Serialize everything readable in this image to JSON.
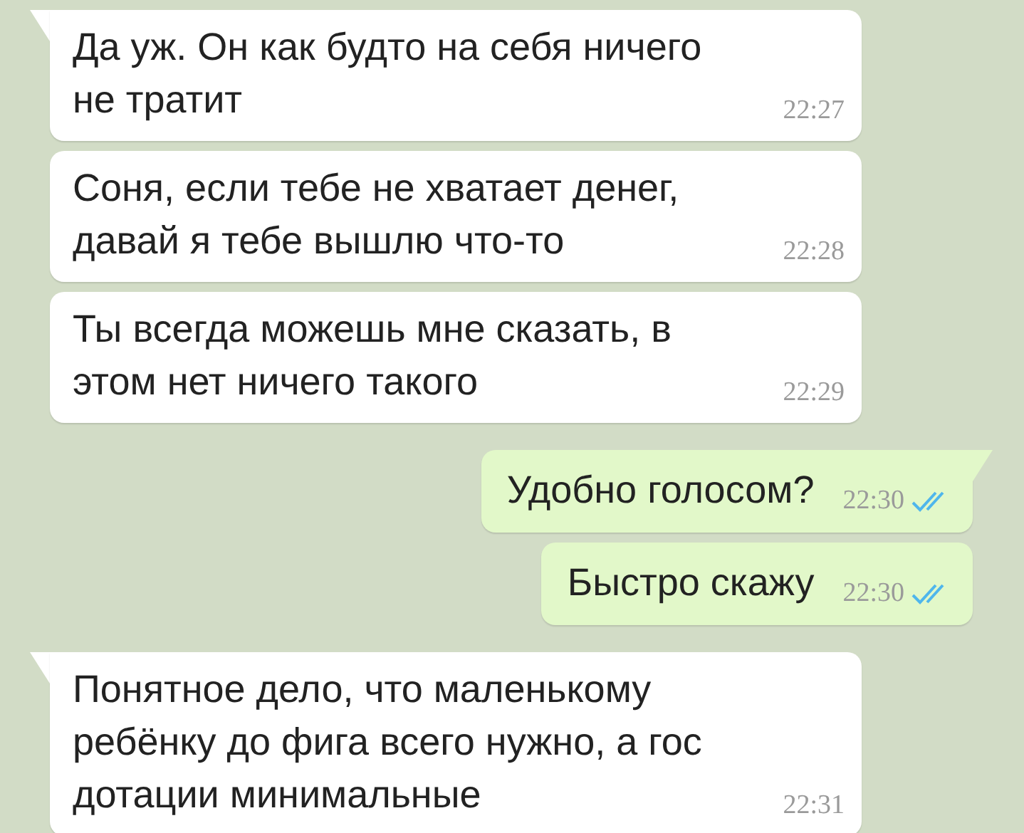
{
  "messages": [
    {
      "kind": "incoming",
      "tail": true,
      "text": "Да уж. Он как будто на себя ничего\nне тратит",
      "time": "22:27"
    },
    {
      "kind": "incoming",
      "tail": false,
      "text": "Соня, если тебе не хватает денег,\nдавай я тебе вышлю что-то",
      "time": "22:28"
    },
    {
      "kind": "incoming",
      "tail": false,
      "text": "Ты всегда можешь мне сказать, в\nэтом нет ничего такого",
      "time": "22:29"
    },
    {
      "kind": "outgoing",
      "tail": true,
      "text": "Удобно голосом?",
      "time": "22:30",
      "read": true
    },
    {
      "kind": "outgoing",
      "tail": false,
      "text": "Быстро скажу",
      "time": "22:30",
      "read": true
    },
    {
      "kind": "incoming",
      "tail": true,
      "text": "Понятное дело, что маленькому\nребёнку до фига всего нужно, а гос\nдотации минимальные",
      "time": "22:31"
    }
  ]
}
